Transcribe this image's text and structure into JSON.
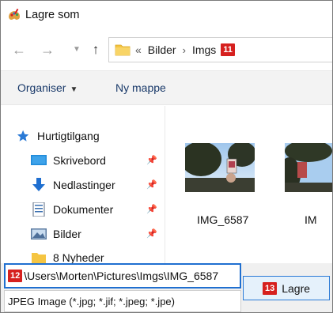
{
  "window": {
    "title": "Lagre som"
  },
  "navigation": {
    "back_icon": "arrow-left-icon",
    "forward_icon": "arrow-right-icon",
    "up_icon": "arrow-up-icon",
    "breadcrumb_overflow": "«",
    "breadcrumbs": [
      "Bilder",
      "Imgs"
    ],
    "callout_11": "11"
  },
  "toolbar": {
    "organise_label": "Organiser",
    "new_folder_label": "Ny mappe"
  },
  "sidebar": {
    "items": [
      {
        "label": "Hurtigtilgang",
        "icon": "star-icon"
      },
      {
        "label": "Skrivebord",
        "icon": "desktop-icon",
        "pinned": true
      },
      {
        "label": "Nedlastinger",
        "icon": "download-icon",
        "pinned": true
      },
      {
        "label": "Dokumenter",
        "icon": "documents-icon",
        "pinned": true
      },
      {
        "label": "Bilder",
        "icon": "pictures-icon",
        "pinned": true
      },
      {
        "label": "8 Nyheder",
        "icon": "folder-icon"
      }
    ]
  },
  "files": [
    {
      "name": "IMG_6587"
    },
    {
      "name": "IM"
    }
  ],
  "save": {
    "filename_value": "\\Users\\Morten\\Pictures\\Imgs\\IMG_6587",
    "callout_12": "12",
    "filetype_value": "JPEG Image (*.jpg; *.jif; *.jpeg; *.jpe)",
    "save_label": "Lagre",
    "callout_13": "13"
  },
  "colors": {
    "callout_badge": "#d6201e",
    "focus_border": "#1f6fd0",
    "accent_blue": "#2a7ad6"
  }
}
